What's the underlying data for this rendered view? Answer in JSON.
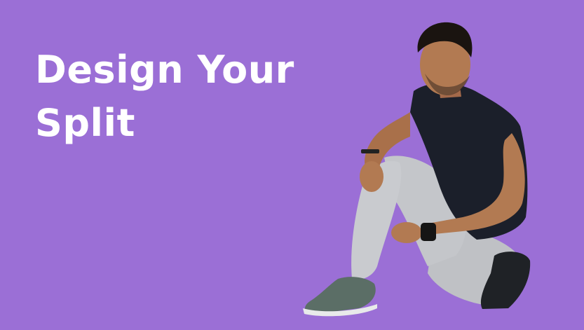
{
  "headline": {
    "line1": "Design Your",
    "line2": "Split"
  },
  "colors": {
    "background": "#9b6fd6",
    "headline_text": "#ffffff",
    "shirt": "#1b1f2a",
    "pants": "#c4c6ca",
    "shoes": "#5b6e66",
    "skin": "#b27a52",
    "hair": "#1a1410"
  },
  "image": {
    "subject": "man-crouching-photo"
  }
}
